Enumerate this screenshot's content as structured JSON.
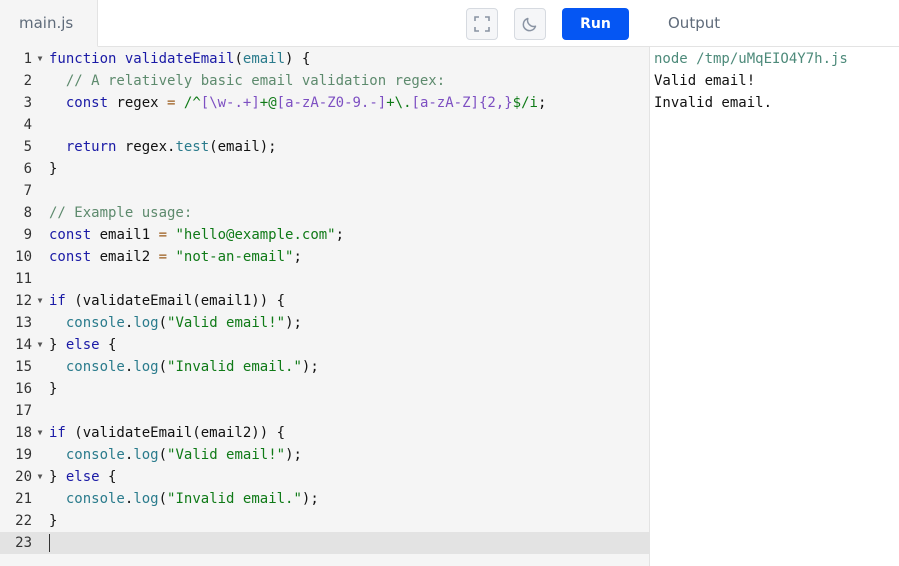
{
  "editor": {
    "file_tab": "main.js",
    "run_label": "Run",
    "fullscreen_icon": "fullscreen-icon",
    "theme_icon": "moon-icon",
    "accent_color": "#0556f3",
    "active_line": 23,
    "lines": [
      {
        "n": "1",
        "fold": true,
        "tokens": [
          [
            "kw",
            "function"
          ],
          [
            "plain",
            " "
          ],
          [
            "fn",
            "validateEmail"
          ],
          [
            "plain",
            "("
          ],
          [
            "param",
            "email"
          ],
          [
            "plain",
            ") {"
          ]
        ]
      },
      {
        "n": "2",
        "fold": false,
        "tokens": [
          [
            "plain",
            "  "
          ],
          [
            "cm",
            "// A relatively basic email validation regex:"
          ]
        ]
      },
      {
        "n": "3",
        "fold": false,
        "tokens": [
          [
            "plain",
            "  "
          ],
          [
            "kw",
            "const"
          ],
          [
            "plain",
            " regex "
          ],
          [
            "op",
            "="
          ],
          [
            "plain",
            " "
          ],
          [
            "re",
            "/^"
          ],
          [
            "rec",
            "[\\w-.+]"
          ],
          [
            "re",
            "+@"
          ],
          [
            "rec",
            "[a-zA-Z0-9.-]"
          ],
          [
            "re",
            "+\\."
          ],
          [
            "rec",
            "[a-zA-Z]"
          ],
          [
            "rec",
            "{2,}"
          ],
          [
            "re",
            "$/i"
          ],
          [
            "plain",
            ";"
          ]
        ]
      },
      {
        "n": "4",
        "fold": false,
        "tokens": []
      },
      {
        "n": "5",
        "fold": false,
        "tokens": [
          [
            "plain",
            "  "
          ],
          [
            "kw",
            "return"
          ],
          [
            "plain",
            " regex."
          ],
          [
            "meth",
            "test"
          ],
          [
            "plain",
            "(email);"
          ]
        ]
      },
      {
        "n": "6",
        "fold": false,
        "tokens": [
          [
            "plain",
            "}"
          ]
        ]
      },
      {
        "n": "7",
        "fold": false,
        "tokens": []
      },
      {
        "n": "8",
        "fold": false,
        "tokens": [
          [
            "cm",
            "// Example usage:"
          ]
        ]
      },
      {
        "n": "9",
        "fold": false,
        "tokens": [
          [
            "kw",
            "const"
          ],
          [
            "plain",
            " email1 "
          ],
          [
            "op",
            "="
          ],
          [
            "plain",
            " "
          ],
          [
            "str",
            "\"hello@example.com\""
          ],
          [
            "plain",
            ";"
          ]
        ]
      },
      {
        "n": "10",
        "fold": false,
        "tokens": [
          [
            "kw",
            "const"
          ],
          [
            "plain",
            " email2 "
          ],
          [
            "op",
            "="
          ],
          [
            "plain",
            " "
          ],
          [
            "str",
            "\"not-an-email\""
          ],
          [
            "plain",
            ";"
          ]
        ]
      },
      {
        "n": "11",
        "fold": false,
        "tokens": []
      },
      {
        "n": "12",
        "fold": true,
        "tokens": [
          [
            "kw",
            "if"
          ],
          [
            "plain",
            " (validateEmail(email1)) {"
          ]
        ]
      },
      {
        "n": "13",
        "fold": false,
        "tokens": [
          [
            "plain",
            "  "
          ],
          [
            "meth",
            "console"
          ],
          [
            "plain",
            "."
          ],
          [
            "meth",
            "log"
          ],
          [
            "plain",
            "("
          ],
          [
            "str",
            "\"Valid email!\""
          ],
          [
            "plain",
            ");"
          ]
        ]
      },
      {
        "n": "14",
        "fold": true,
        "tokens": [
          [
            "plain",
            "} "
          ],
          [
            "kw",
            "else"
          ],
          [
            "plain",
            " {"
          ]
        ]
      },
      {
        "n": "15",
        "fold": false,
        "tokens": [
          [
            "plain",
            "  "
          ],
          [
            "meth",
            "console"
          ],
          [
            "plain",
            "."
          ],
          [
            "meth",
            "log"
          ],
          [
            "plain",
            "("
          ],
          [
            "str",
            "\"Invalid email.\""
          ],
          [
            "plain",
            ");"
          ]
        ]
      },
      {
        "n": "16",
        "fold": false,
        "tokens": [
          [
            "plain",
            "}"
          ]
        ]
      },
      {
        "n": "17",
        "fold": false,
        "tokens": []
      },
      {
        "n": "18",
        "fold": true,
        "tokens": [
          [
            "kw",
            "if"
          ],
          [
            "plain",
            " (validateEmail(email2)) {"
          ]
        ]
      },
      {
        "n": "19",
        "fold": false,
        "tokens": [
          [
            "plain",
            "  "
          ],
          [
            "meth",
            "console"
          ],
          [
            "plain",
            "."
          ],
          [
            "meth",
            "log"
          ],
          [
            "plain",
            "("
          ],
          [
            "str",
            "\"Valid email!\""
          ],
          [
            "plain",
            ");"
          ]
        ]
      },
      {
        "n": "20",
        "fold": true,
        "tokens": [
          [
            "plain",
            "} "
          ],
          [
            "kw",
            "else"
          ],
          [
            "plain",
            " {"
          ]
        ]
      },
      {
        "n": "21",
        "fold": false,
        "tokens": [
          [
            "plain",
            "  "
          ],
          [
            "meth",
            "console"
          ],
          [
            "plain",
            "."
          ],
          [
            "meth",
            "log"
          ],
          [
            "plain",
            "("
          ],
          [
            "str",
            "\"Invalid email.\""
          ],
          [
            "plain",
            ");"
          ]
        ]
      },
      {
        "n": "22",
        "fold": false,
        "tokens": [
          [
            "plain",
            "}"
          ]
        ]
      },
      {
        "n": "23",
        "fold": false,
        "tokens": []
      }
    ]
  },
  "output": {
    "title": "Output",
    "command": "node /tmp/uMqEIO4Y7h.js",
    "lines": [
      "Valid email!",
      "Invalid email."
    ]
  }
}
